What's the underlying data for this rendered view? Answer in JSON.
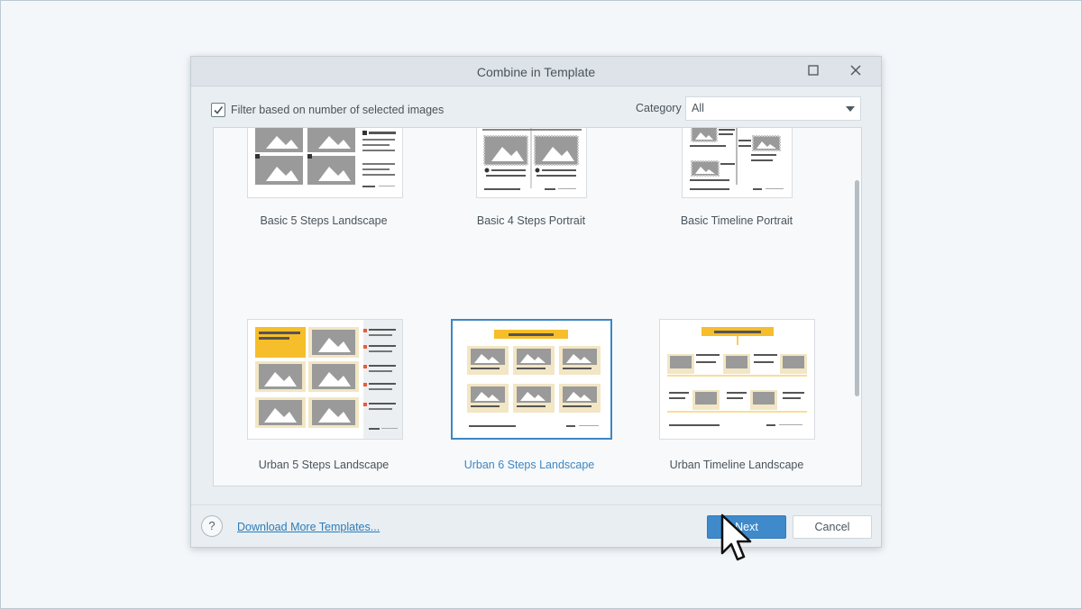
{
  "dialog": {
    "title": "Combine in Template",
    "maximize_icon": "square-icon",
    "close_icon": "close-icon"
  },
  "filter": {
    "checked": true,
    "label": "Filter based on number of selected images"
  },
  "category": {
    "label": "Category",
    "selected": "All"
  },
  "templates": [
    {
      "name": "Basic 5 Steps Landscape",
      "selected": false
    },
    {
      "name": "Basic 4 Steps Portrait",
      "selected": false
    },
    {
      "name": "Basic Timeline Portrait",
      "selected": false
    },
    {
      "name": "Urban 5 Steps Landscape",
      "selected": false
    },
    {
      "name": "Urban 6 Steps Landscape",
      "selected": true
    },
    {
      "name": "Urban Timeline Landscape",
      "selected": false
    }
  ],
  "footer": {
    "help_label": "?",
    "download_link": "Download More Templates...",
    "next_label": "Next",
    "cancel_label": "Cancel"
  },
  "colors": {
    "accent": "#3e8acb",
    "urban_yellow": "#f6be2a",
    "placeholder_gray": "#9a9a9a"
  }
}
